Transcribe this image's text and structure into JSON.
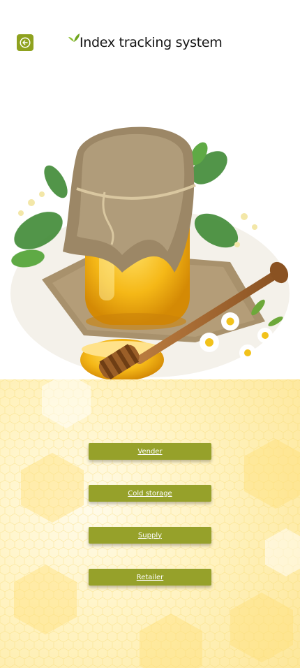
{
  "header": {
    "title": "Index tracking system",
    "back_icon": "arrow-left-icon",
    "logo_icon": "leaf-icon"
  },
  "hero": {
    "image": "honey-jar-illustration"
  },
  "menu": [
    {
      "label": "Vender"
    },
    {
      "label": "Cold storage"
    },
    {
      "label": "Supply"
    },
    {
      "label": "Retailer"
    }
  ],
  "colors": {
    "accent": "#8fa21f",
    "button": "#96a12a",
    "honey": "#f5b817",
    "panel_bg": "#fff3c2"
  }
}
